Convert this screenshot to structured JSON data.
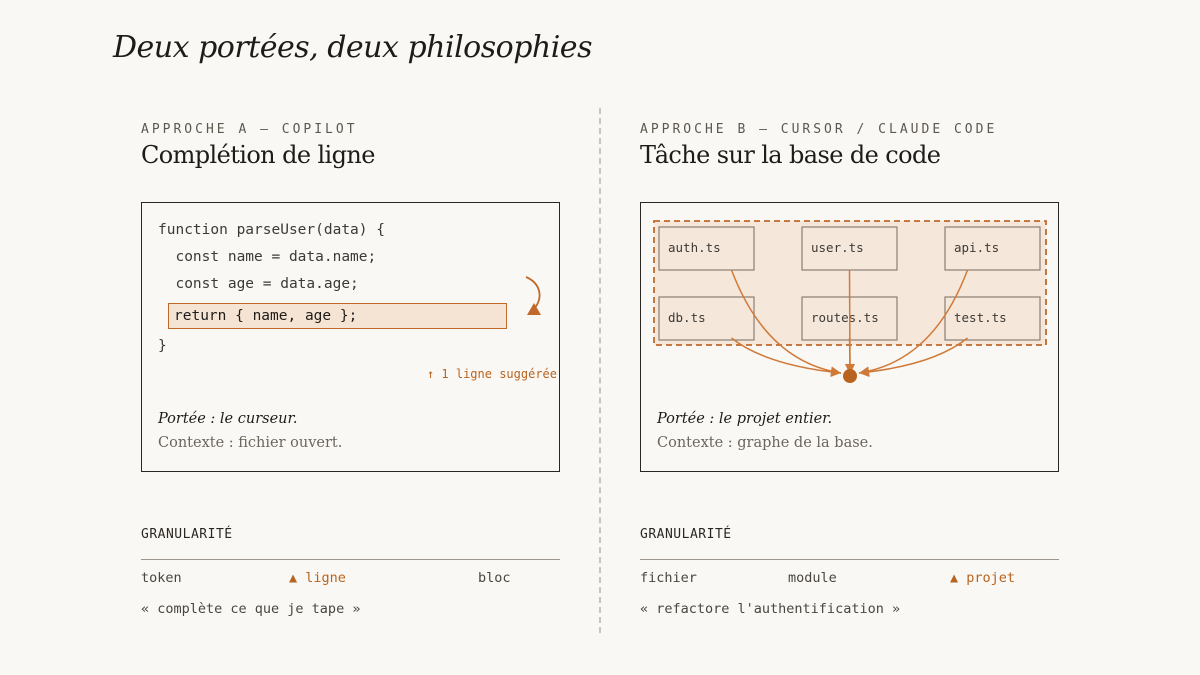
{
  "title": "Deux portées, deux philosophies",
  "colors": {
    "accent": "#c0692b",
    "accent_fill": "#f5e3d3",
    "ink": "#2b2824",
    "background": "#faf8f4"
  },
  "left": {
    "kicker": "APPROCHE A — COPILOT",
    "heading": "Complétion de ligne",
    "code_lines": [
      "function parseUser(data) {",
      "  const name = data.name;",
      "  const age = data.age;"
    ],
    "suggested_line": "return { name, age };",
    "closing_line": "}",
    "suggestion_note": "↑ 1 ligne suggérée",
    "scope": "Portée : le curseur.",
    "context": "Contexte : fichier ouvert.",
    "granularity": {
      "label": "GRANULARITÉ",
      "items": [
        "token",
        "▲ ligne",
        "bloc"
      ],
      "active_index": 1,
      "quote": "« complète ce que je tape »"
    }
  },
  "right": {
    "kicker": "APPROCHE B — CURSOR / CLAUDE CODE",
    "heading": "Tâche sur la base de code",
    "files": [
      "auth.ts",
      "user.ts",
      "api.ts",
      "db.ts",
      "routes.ts",
      "test.ts"
    ],
    "scope": "Portée : le projet entier.",
    "context": "Contexte : graphe de la base.",
    "granularity": {
      "label": "GRANULARITÉ",
      "items": [
        "fichier",
        "module",
        "▲ projet"
      ],
      "active_index": 2,
      "quote": "« refactore l'authentification »"
    }
  }
}
